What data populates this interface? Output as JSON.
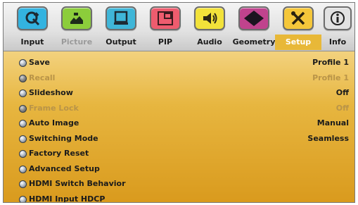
{
  "tabs": [
    {
      "label": "Input",
      "icon": "input-icon",
      "color": "#33b3e0",
      "state": "normal"
    },
    {
      "label": "Picture",
      "icon": "picture-icon",
      "color": "#8ccd3b",
      "state": "dim"
    },
    {
      "label": "Output",
      "icon": "output-icon",
      "color": "#3fb6d8",
      "state": "normal"
    },
    {
      "label": "PIP",
      "icon": "pip-icon",
      "color": "#ee5c6e",
      "state": "normal"
    },
    {
      "label": "Audio",
      "icon": "audio-icon",
      "color": "#f2e23a",
      "state": "normal"
    },
    {
      "label": "Geometry",
      "icon": "geometry-icon",
      "color": "#c0438d",
      "state": "normal"
    },
    {
      "label": "Setup",
      "icon": "setup-icon",
      "color": "#f5c73a",
      "state": "active"
    },
    {
      "label": "Info",
      "icon": "info-icon",
      "color": "#e2e2e2",
      "state": "normal"
    }
  ],
  "menu": {
    "items": [
      {
        "label": "Save",
        "value": "Profile 1",
        "state": "normal"
      },
      {
        "label": "Recall",
        "value": "Profile 1",
        "state": "dim"
      },
      {
        "label": "Slideshow",
        "value": "Off",
        "state": "normal"
      },
      {
        "label": "Frame Lock",
        "value": "Off",
        "state": "dim"
      },
      {
        "label": "Auto Image",
        "value": "Manual",
        "state": "normal"
      },
      {
        "label": "Switching Mode",
        "value": "Seamless",
        "state": "normal"
      },
      {
        "label": "Factory Reset",
        "value": "",
        "state": "normal"
      },
      {
        "label": "Advanced Setup",
        "value": "",
        "state": "normal"
      },
      {
        "label": "HDMI Switch Behavior",
        "value": "",
        "state": "normal"
      },
      {
        "label": "HDMI Input HDCP",
        "value": "",
        "state": "normal"
      }
    ]
  }
}
